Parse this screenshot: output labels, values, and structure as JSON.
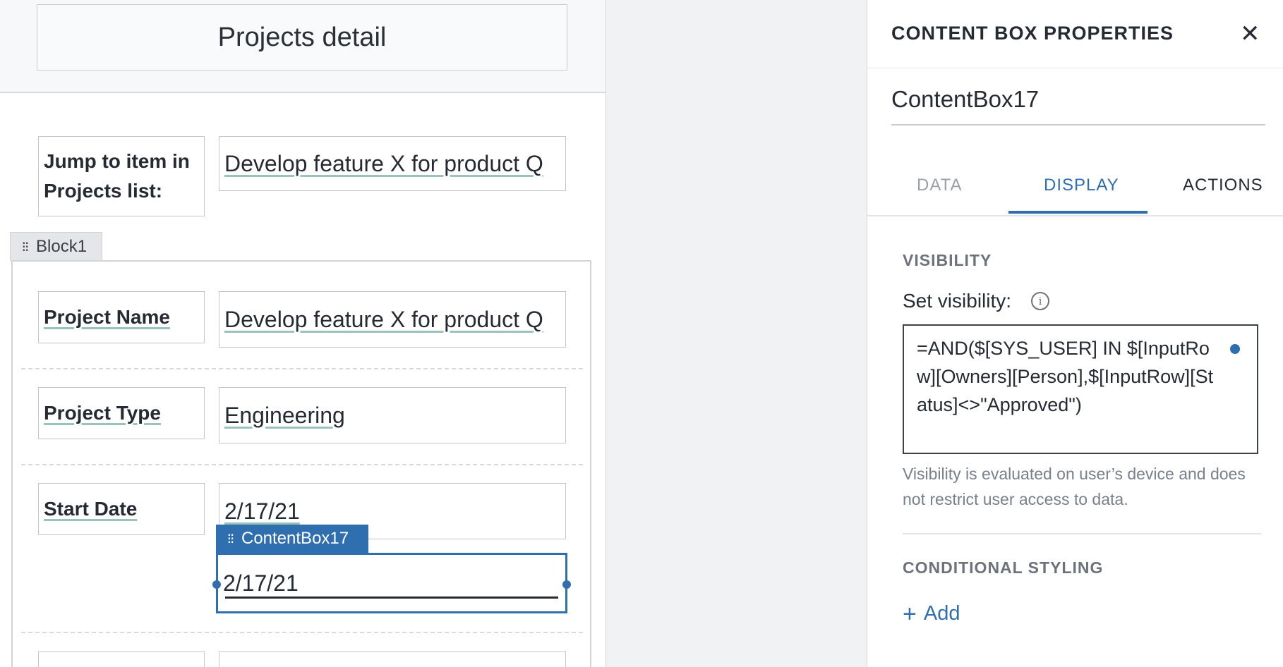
{
  "canvas": {
    "title": "Projects detail",
    "jump": {
      "label": "Jump to item in Projects list:",
      "value": "Develop feature X for product Q"
    },
    "block_name": "Block1",
    "fields": [
      {
        "label": "Project Name",
        "value": "Develop feature X for product Q"
      },
      {
        "label": "Project Type",
        "value": "Engineering"
      },
      {
        "label": "Start Date",
        "value": "2/17/21"
      }
    ],
    "selected_box": {
      "name": "ContentBox17",
      "value": "2/17/21"
    }
  },
  "properties": {
    "title": "CONTENT BOX PROPERTIES",
    "close_icon": "close-icon",
    "name": "ContentBox17",
    "tabs": [
      "DATA",
      "DISPLAY",
      "ACTIONS"
    ],
    "active_tab": "DISPLAY",
    "visibility": {
      "section_title": "VISIBILITY",
      "label": "Set visibility:",
      "formula": "=AND($[SYS_USER] IN $[InputRow][Owners][Person],$[InputRow][Status]<>\"Approved\")",
      "helper": "Visibility is evaluated on user’s device and does not restrict user access to data."
    },
    "conditional_styling": {
      "section_title": "CONDITIONAL STYLING",
      "add_label": "Add"
    }
  },
  "colors": {
    "accent": "#2f6fb0",
    "text": "#262b33",
    "muted": "#7a8089"
  }
}
